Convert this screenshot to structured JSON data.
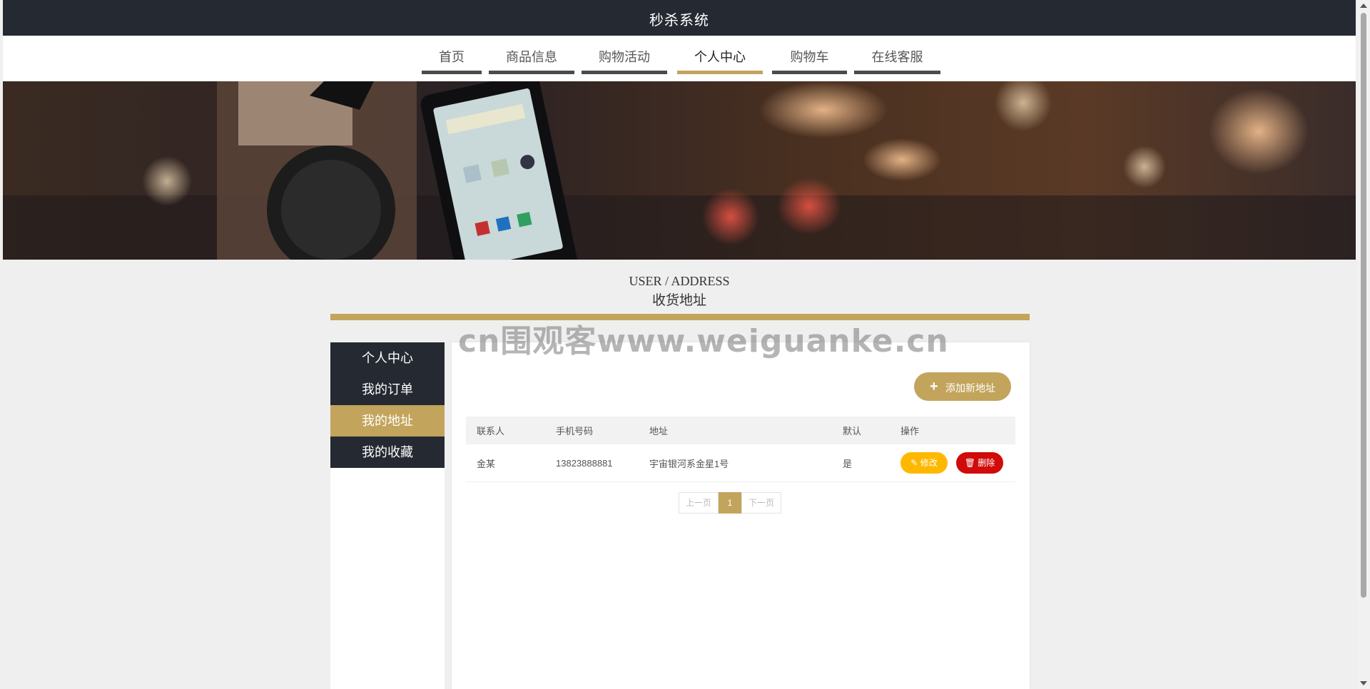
{
  "app": {
    "title": "秒杀系统"
  },
  "nav": {
    "tabs": [
      {
        "label": "首页"
      },
      {
        "label": "商品信息"
      },
      {
        "label": "购物活动"
      },
      {
        "label": "个人中心"
      },
      {
        "label": "购物车"
      },
      {
        "label": "在线客服"
      }
    ],
    "active_index": 3
  },
  "section": {
    "title_en": "USER / ADDRESS",
    "title_cn": "收货地址"
  },
  "sidebar": {
    "items": [
      {
        "label": "个人中心"
      },
      {
        "label": "我的订单"
      },
      {
        "label": "我的地址"
      },
      {
        "label": "我的收藏"
      }
    ],
    "active_index": 2
  },
  "main": {
    "add_button": "添加新地址",
    "table": {
      "headers": [
        "联系人",
        "手机号码",
        "地址",
        "默认",
        "操作"
      ],
      "rows": [
        {
          "name": "金某",
          "phone": "13823888881",
          "address": "宇宙银河系金星1号",
          "default": "是",
          "edit": "修改",
          "delete": "删除"
        }
      ]
    },
    "pagination": {
      "prev": "上一页",
      "current": "1",
      "next": "下一页"
    }
  },
  "watermark": "cn围观客www.weiguanke.cn",
  "colors": {
    "header_bg": "#252932",
    "accent_gold": "#c3a45c",
    "edit_yellow": "#ffb800",
    "delete_red": "#d10a0a"
  }
}
